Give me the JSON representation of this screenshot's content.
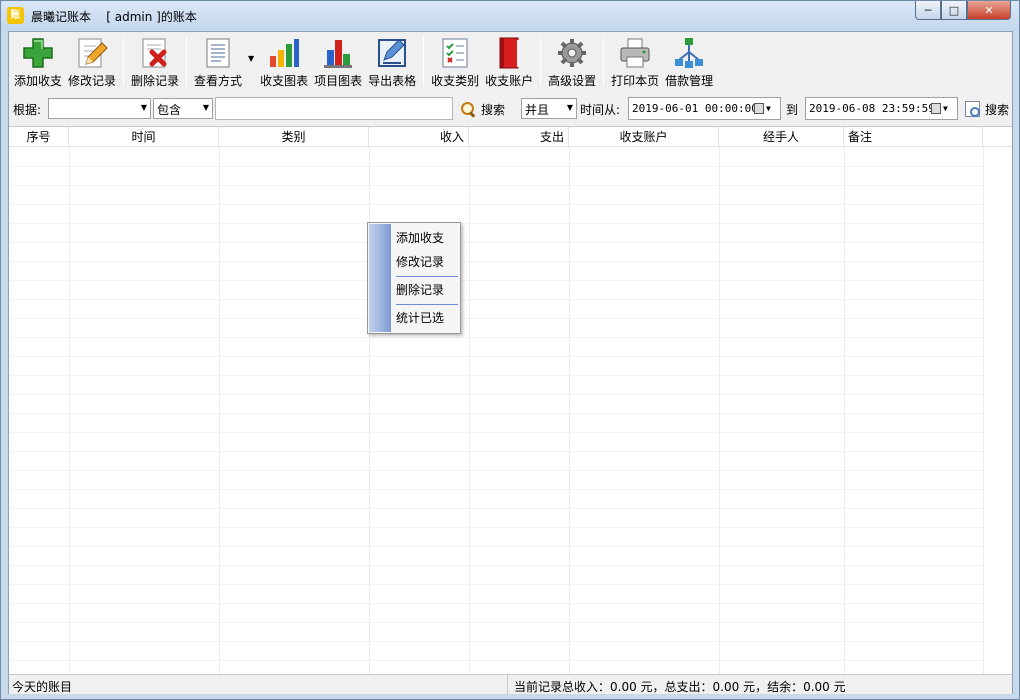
{
  "window": {
    "app_icon_text": "账",
    "title": "晨曦记账本    [ admin ]的账本"
  },
  "toolbar": {
    "items": [
      {
        "label": "添加收支",
        "icon": "add-icon"
      },
      {
        "label": "修改记录",
        "icon": "edit-icon"
      },
      {
        "label": "删除记录",
        "icon": "delete-icon"
      },
      {
        "label": "查看方式",
        "icon": "view-icon"
      },
      {
        "label": "收支图表",
        "icon": "bar-chart-icon"
      },
      {
        "label": "项目图表",
        "icon": "project-chart-icon"
      },
      {
        "label": "导出表格",
        "icon": "export-icon"
      },
      {
        "label": "收支类别",
        "icon": "category-icon"
      },
      {
        "label": "收支账户",
        "icon": "account-book-icon"
      },
      {
        "label": "高级设置",
        "icon": "gear-icon"
      },
      {
        "label": "打印本页",
        "icon": "printer-icon"
      },
      {
        "label": "借款管理",
        "icon": "network-icon"
      }
    ]
  },
  "filter": {
    "basis_label": "根据:",
    "basis_value": "",
    "match_value": "包含",
    "keyword_value": "",
    "search_label": "搜索",
    "logic_value": "并且",
    "time_from_label": "时间从:",
    "time_from_value": "2019-06-01 00:00:00",
    "to_label": "到",
    "time_to_value": "2019-06-08 23:59:59",
    "search2_label": "搜索"
  },
  "table": {
    "columns": [
      "序号",
      "时间",
      "类别",
      "收入",
      "支出",
      "收支账户",
      "经手人",
      "备注"
    ],
    "rows": []
  },
  "context_menu": {
    "items": [
      "添加收支",
      "修改记录",
      "删除记录",
      "统计已选"
    ]
  },
  "status": {
    "left": "今天的账目",
    "right": "当前记录总收入：0.00 元，总支出：0.00 元，结余：0.00 元"
  }
}
